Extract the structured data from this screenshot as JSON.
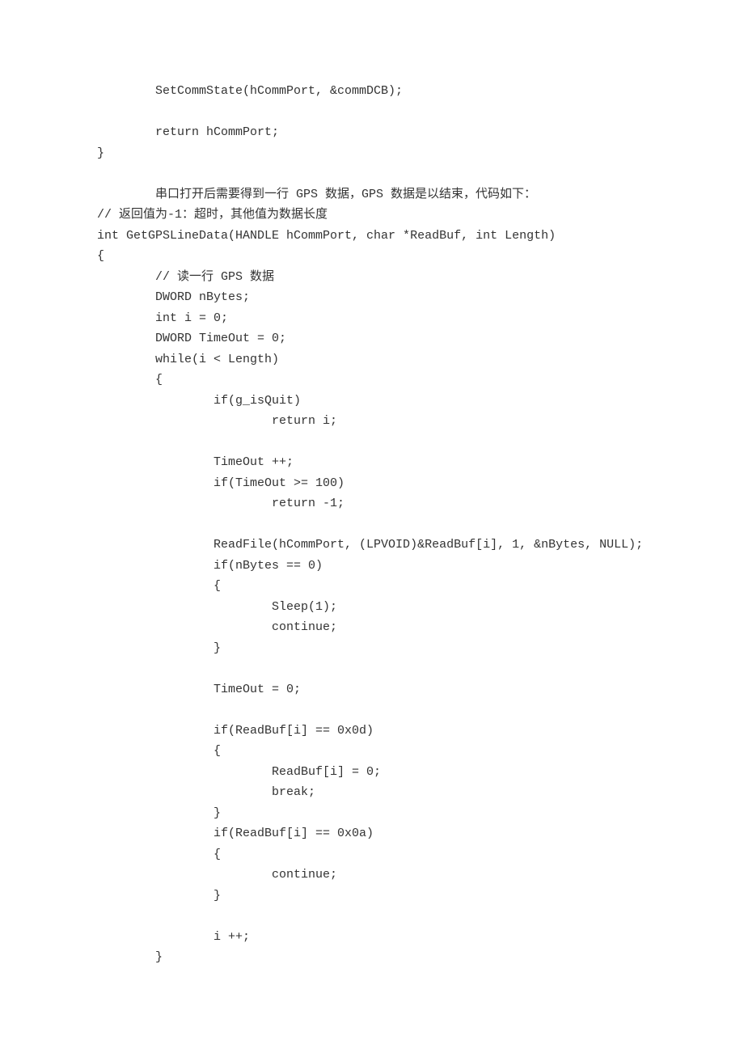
{
  "lines": [
    "        SetCommState(hCommPort, &commDCB);",
    "",
    "        return hCommPort;",
    "}",
    "",
    "        串口打开后需要得到一行 GPS 数据，GPS 数据是以结束，代码如下：",
    "// 返回值为-1：超时，其他值为数据长度",
    "int GetGPSLineData(HANDLE hCommPort, char *ReadBuf, int Length)",
    "{",
    "        // 读一行 GPS 数据",
    "        DWORD nBytes;",
    "        int i = 0;",
    "        DWORD TimeOut = 0;",
    "        while(i < Length)",
    "        {",
    "                if(g_isQuit)",
    "                        return i;",
    "",
    "                TimeOut ++;",
    "                if(TimeOut >= 100)",
    "                        return -1;",
    "",
    "                ReadFile(hCommPort, (LPVOID)&ReadBuf[i], 1, &nBytes, NULL);",
    "                if(nBytes == 0)",
    "                {",
    "                        Sleep(1);",
    "                        continue;",
    "                }",
    "",
    "                TimeOut = 0;",
    "",
    "                if(ReadBuf[i] == 0x0d)",
    "                {",
    "                        ReadBuf[i] = 0;",
    "                        break;",
    "                }",
    "                if(ReadBuf[i] == 0x0a)",
    "                {",
    "                        continue;",
    "                }",
    "",
    "                i ++;",
    "        }"
  ]
}
